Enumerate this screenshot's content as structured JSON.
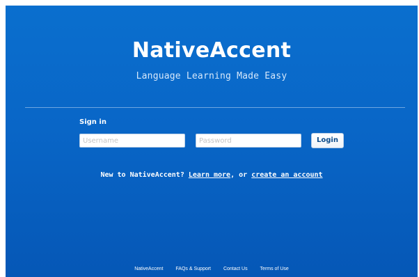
{
  "header": {
    "brand": "NativeAccent",
    "tagline": "Language Learning Made Easy"
  },
  "signin": {
    "heading": "Sign in",
    "username_placeholder": "Username",
    "password_placeholder": "Password",
    "login_label": "Login"
  },
  "prompt": {
    "prefix": "New to NativeAccent? ",
    "learn_more": "Learn more",
    "middle": ", or ",
    "create_account": "create an account"
  },
  "footer": {
    "links": [
      "NativeAccent",
      "FAQs & Support",
      "Contact Us",
      "Terms of Use"
    ]
  },
  "colors": {
    "background": "#0966c7",
    "text": "#ffffff"
  }
}
